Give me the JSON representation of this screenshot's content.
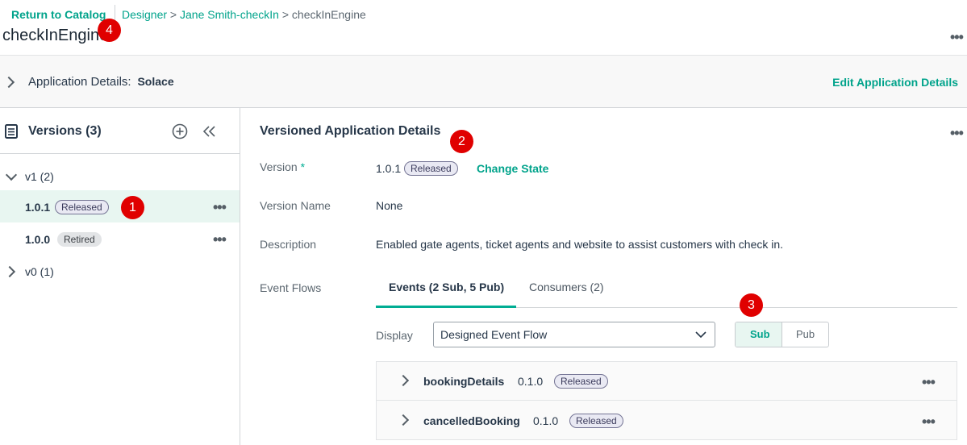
{
  "breadcrumb": {
    "return_label": "Return to Catalog",
    "designer": "Designer",
    "sep1": ">",
    "app": "Jane Smith-checkIn",
    "sep2": ">",
    "current": "checkInEngine"
  },
  "page_title": "checkInEngine",
  "app_details": {
    "label": "Application Details:",
    "value": "Solace",
    "edit_label": "Edit Application Details"
  },
  "versions_panel": {
    "title": "Versions (3)",
    "groups": [
      {
        "label": "v1 (2)",
        "items": [
          {
            "version": "1.0.1",
            "state": "Released"
          },
          {
            "version": "1.0.0",
            "state": "Retired"
          }
        ]
      },
      {
        "label": "v0 (1)"
      }
    ]
  },
  "details": {
    "title": "Versioned Application Details",
    "version_label": "Version",
    "required_mark": "*",
    "version_value": "1.0.1",
    "version_state": "Released",
    "change_state_label": "Change State",
    "version_name_label": "Version Name",
    "version_name_value": "None",
    "description_label": "Description",
    "description_value": "Enabled gate agents, ticket agents and website to assist customers with check in.",
    "event_flows_label": "Event Flows",
    "tabs": [
      {
        "label": "Events (2 Sub, 5 Pub)"
      },
      {
        "label": "Consumers (2)"
      }
    ],
    "display_label": "Display",
    "display_value": "Designed Event Flow",
    "toggle": {
      "sub": "Sub",
      "pub": "Pub"
    },
    "events": [
      {
        "name": "bookingDetails",
        "version": "0.1.0",
        "state": "Released"
      },
      {
        "name": "cancelledBooking",
        "version": "0.1.0",
        "state": "Released"
      }
    ]
  },
  "markers": [
    "1",
    "2",
    "3",
    "4"
  ],
  "colors": {
    "accent": "#00ad93",
    "selected_row": "#e8f6f1",
    "marker": "#e00000"
  }
}
